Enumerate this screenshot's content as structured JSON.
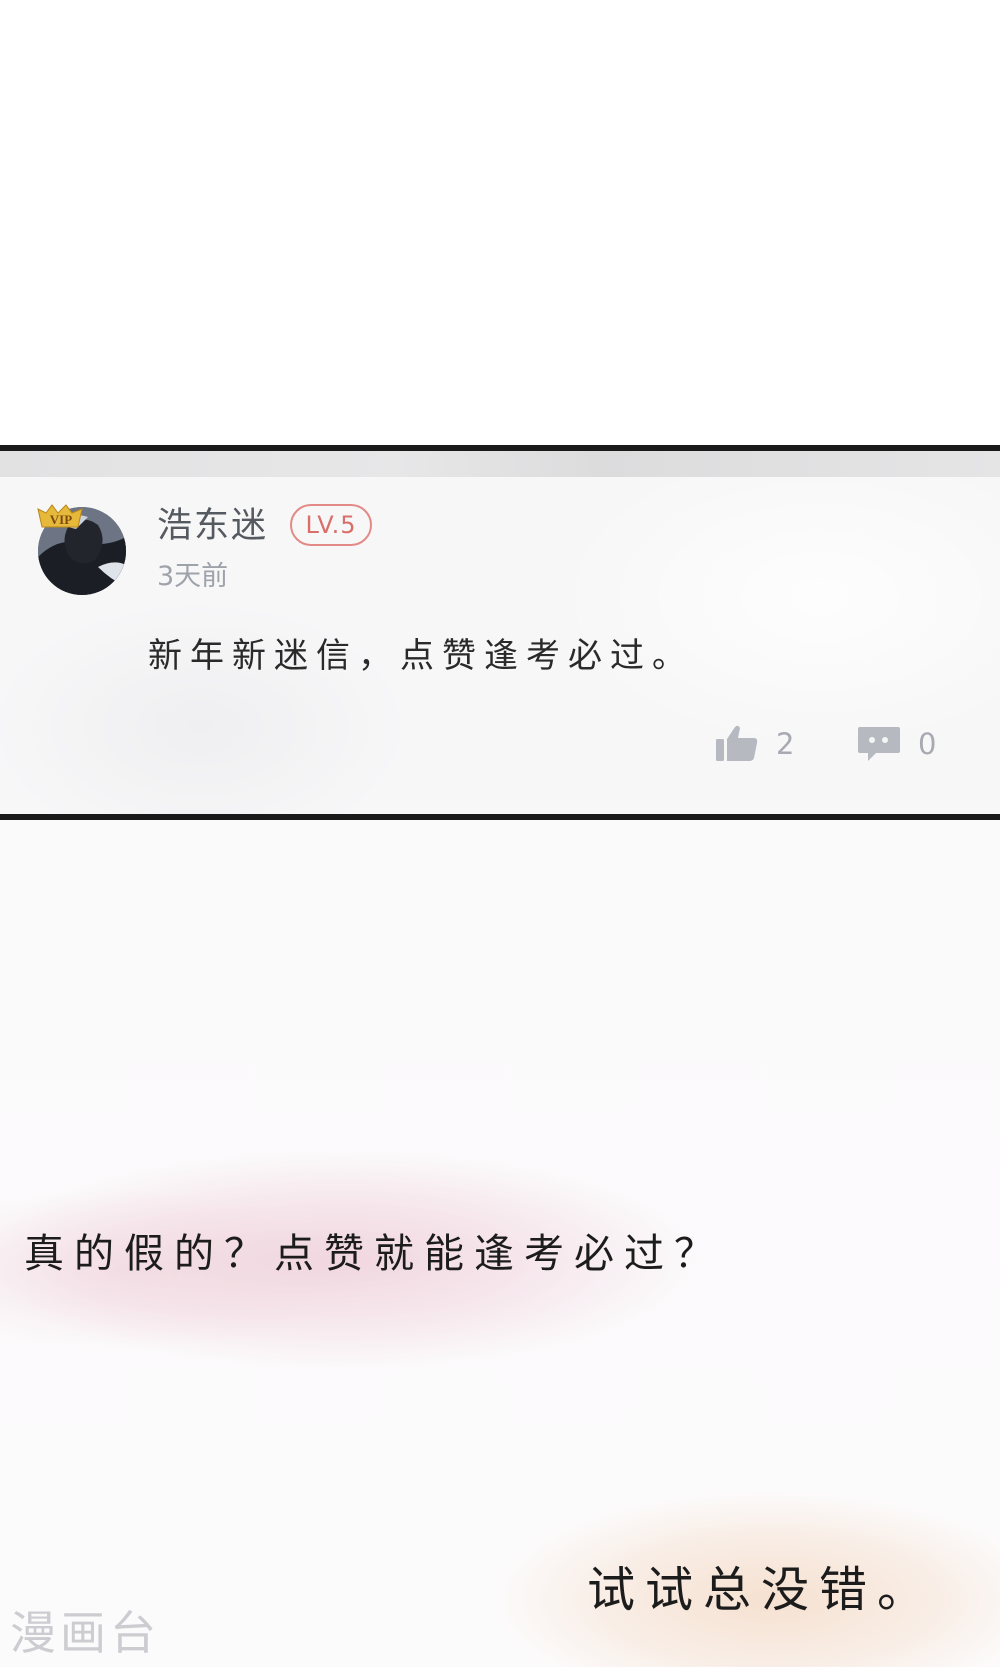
{
  "comment": {
    "username": "浩东迷",
    "vip_label": "VIP",
    "level": "LV.5",
    "timestamp": "3天前",
    "text": "新年新迷信，点赞逢考必过。",
    "like_count": "2",
    "reply_count": "0",
    "like_icon": "thumbs-up-icon",
    "reply_icon": "comment-bubble-icon"
  },
  "captions": {
    "first": "真的假的？点赞就能逢考必过？",
    "second": "试试总没错。"
  },
  "watermark": "漫画台",
  "colors": {
    "level_badge": "#d86f69",
    "panel_border": "#1a1a1a",
    "pink_wash": "#efd0da",
    "peach_wash": "#f5decc"
  }
}
